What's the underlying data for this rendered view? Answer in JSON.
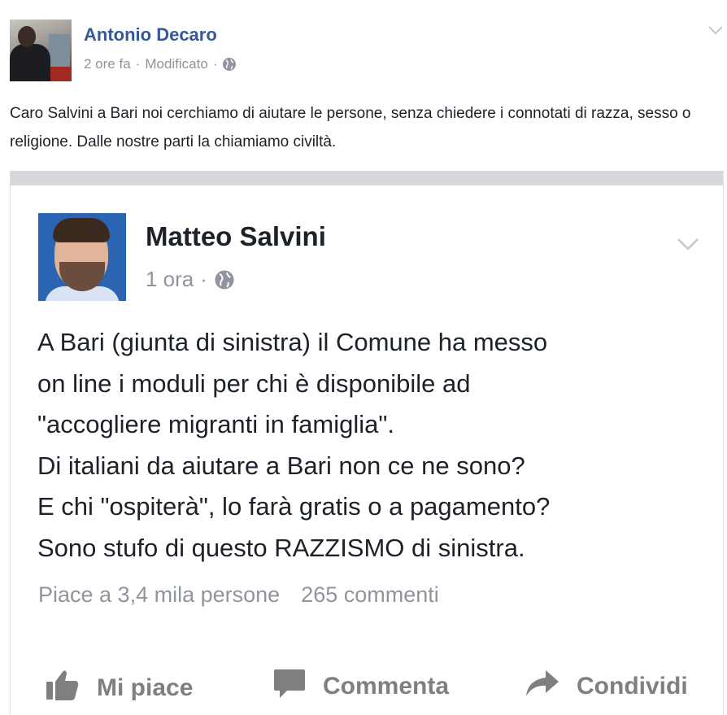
{
  "outer_post": {
    "author": "Antonio Decaro",
    "time": "2 ore fa",
    "separator": "·",
    "edited": "Modificato",
    "text": "Caro Salvini a Bari noi cerchiamo di aiutare le persone, senza chiedere i connotati di razza, sesso o religione. Dalle nostre parti la chiamiamo civiltà."
  },
  "shared_post": {
    "author": "Matteo Salvini",
    "time": "1 ora",
    "separator": "·",
    "lines": [
      "A Bari (giunta di sinistra) il Comune ha messo",
      "on line i moduli per chi è disponibile ad",
      "\"accogliere migranti in famiglia\".",
      "Di italiani da aiutare a Bari non ce ne sono?",
      "E chi \"ospiterà\", lo farà gratis o a pagamento?",
      "Sono stufo di questo RAZZISMO di sinistra."
    ],
    "likes": "Piace a 3,4 mila persone",
    "comments": "265 commenti"
  },
  "actions": {
    "like": "Mi piace",
    "comment": "Commenta",
    "share": "Condividi"
  },
  "icons": {
    "privacy": "globe-icon",
    "menu": "chevron-down-icon",
    "like": "thumbs-up-icon",
    "comment": "speech-bubble-icon",
    "share": "share-arrow-icon"
  },
  "colors": {
    "author_link": "#365899",
    "meta_gray": "#90949c",
    "text": "#1d2129",
    "action_gray": "#7f7f7f"
  }
}
